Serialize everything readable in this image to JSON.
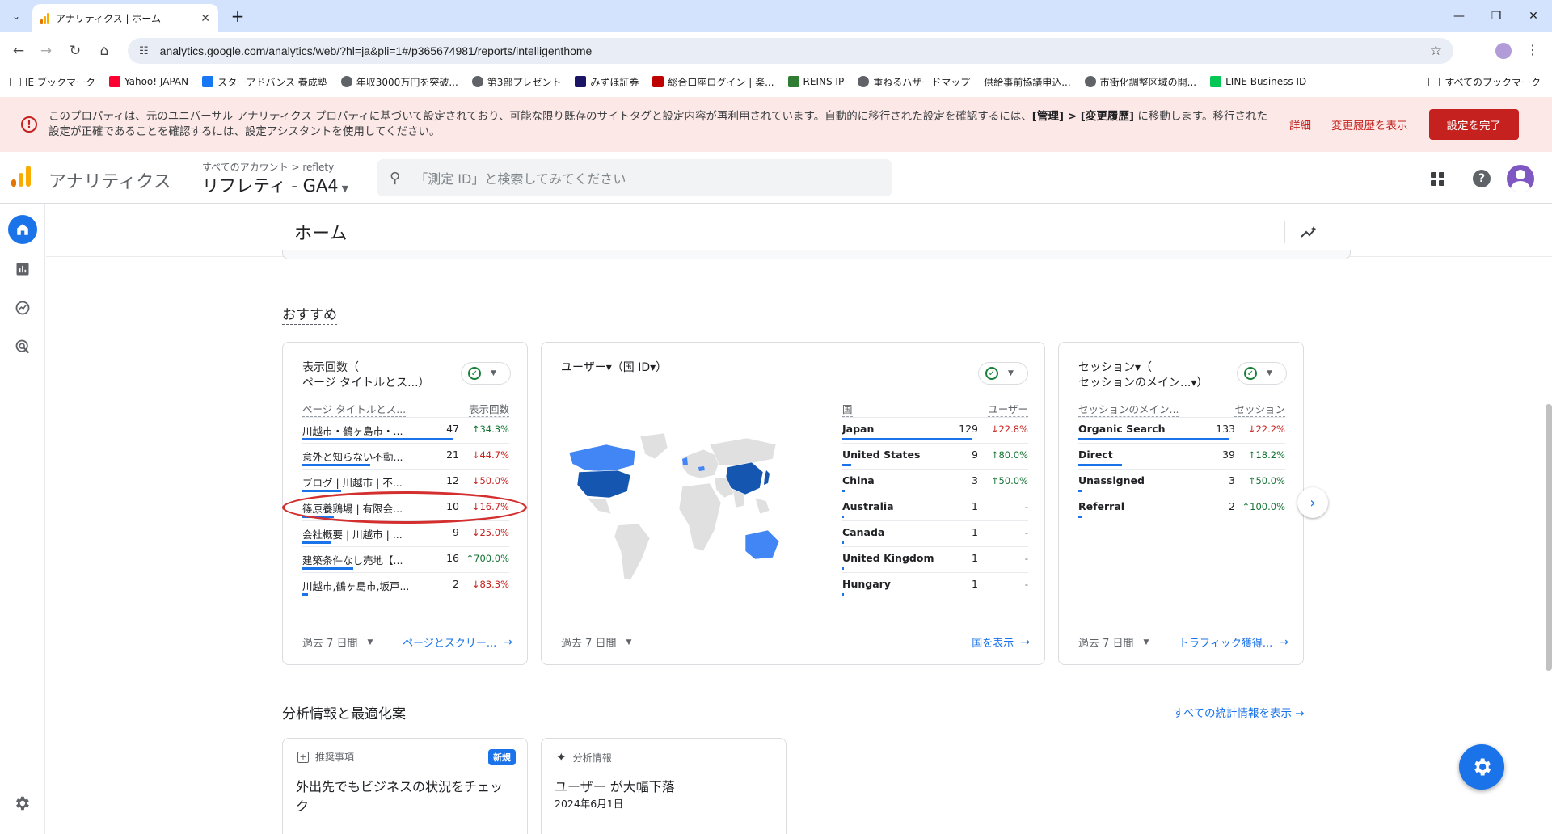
{
  "browser": {
    "tab_title": "アナリティクス | ホーム",
    "url": "analytics.google.com/analytics/web/?hl=ja&pli=1#/p365674981/reports/intelligenthome",
    "bookmarks": [
      {
        "label": "IE ブックマーク",
        "icon": "folder-icon",
        "color": "#5f6368"
      },
      {
        "label": "Yahoo! JAPAN",
        "icon": "yahoo-icon",
        "color": "#ff0033"
      },
      {
        "label": "スターアドバンス 養成塾",
        "icon": "facebook-icon",
        "color": "#1877f2"
      },
      {
        "label": "年収3000万円を突破...",
        "icon": "globe-icon",
        "color": "#5f6368"
      },
      {
        "label": "第3部プレゼント",
        "icon": "globe-icon",
        "color": "#5f6368"
      },
      {
        "label": "みずほ証券",
        "icon": "mizuho-icon",
        "color": "#1b1464"
      },
      {
        "label": "総合口座ログイン | 楽...",
        "icon": "rakuten-icon",
        "color": "#bf0000"
      },
      {
        "label": "REINS IP",
        "icon": "reins-icon",
        "color": "#2e7d32"
      },
      {
        "label": "重ねるハザードマップ",
        "icon": "globe-icon",
        "color": "#5f6368"
      },
      {
        "label": "供給事前協議申込...",
        "icon": "blank-icon",
        "color": "#ffffff"
      },
      {
        "label": "市街化調整区域の開...",
        "icon": "globe-icon",
        "color": "#5f6368"
      },
      {
        "label": "LINE Business ID",
        "icon": "line-icon",
        "color": "#06c755"
      }
    ],
    "all_bookmarks": "すべてのブックマーク"
  },
  "banner": {
    "message_1": "このプロパティは、元のユニバーサル アナリティクス プロパティに基づいて設定されており、可能な限り既存のサイトタグと設定内容が再利用されています。自動的に移行された設定を確認するには、",
    "message_bold": "[管理] > [変更履歴]",
    "message_2": " に移動します。移行された設定が正確であることを確認するには、設定アシスタントを使用してください。",
    "details_link": "詳細",
    "history_link": "変更履歴を表示",
    "done_button": "設定を完了"
  },
  "header": {
    "product": "アナリティクス",
    "breadcrumb": "すべてのアカウント > reflety",
    "property": "リフレティ - GA4",
    "search_placeholder": "「測定 ID」と検索してみてください"
  },
  "main": {
    "title": "ホーム",
    "recommended_heading": "おすすめ",
    "insights_heading": "分析情報と最適化案",
    "all_insights_link": "すべての統計情報を表示"
  },
  "cards": [
    {
      "title_line1": "表示回数（",
      "title_line2": "ページ タイトルとス...）",
      "col_label": "ページ タイトルとス...",
      "col_metric": "表示回数",
      "period": "過去 7 日間",
      "link": "ページとスクリー...",
      "rows": [
        {
          "label": "川越市・鶴ヶ島市・...",
          "value": "47",
          "change": "34.3%",
          "dir": "up",
          "share": 1.0
        },
        {
          "label": "意外と知らない不動...",
          "value": "21",
          "change": "44.7%",
          "dir": "dn",
          "share": 0.45
        },
        {
          "label": "ブログ | 川越市 | 不...",
          "value": "12",
          "change": "50.0%",
          "dir": "dn",
          "share": 0.26
        },
        {
          "label": "篠原養鶏場 | 有限会...",
          "value": "10",
          "change": "16.7%",
          "dir": "dn",
          "share": 0.21
        },
        {
          "label": "会社概要 | 川越市 | ...",
          "value": "9",
          "change": "25.0%",
          "dir": "dn",
          "share": 0.19
        },
        {
          "label": "建築条件なし売地【...",
          "value": "16",
          "change": "700.0%",
          "dir": "up",
          "share": 0.34
        },
        {
          "label": "川越市,鶴ヶ島市,坂戸...",
          "value": "2",
          "change": "83.3%",
          "dir": "dn",
          "share": 0.04
        }
      ]
    },
    {
      "title": "ユーザー▾（国 ID▾）",
      "col_label": "国",
      "col_metric": "ユーザー",
      "period": "過去 7 日間",
      "link": "国を表示",
      "rows": [
        {
          "label": "Japan",
          "value": "129",
          "change": "22.8%",
          "dir": "dn",
          "share": 1.0
        },
        {
          "label": "United States",
          "value": "9",
          "change": "80.0%",
          "dir": "up",
          "share": 0.07
        },
        {
          "label": "China",
          "value": "3",
          "change": "50.0%",
          "dir": "up",
          "share": 0.02
        },
        {
          "label": "Australia",
          "value": "1",
          "change": "-",
          "dir": "nd",
          "share": 0.01
        },
        {
          "label": "Canada",
          "value": "1",
          "change": "-",
          "dir": "nd",
          "share": 0.01
        },
        {
          "label": "United Kingdom",
          "value": "1",
          "change": "-",
          "dir": "nd",
          "share": 0.01
        },
        {
          "label": "Hungary",
          "value": "1",
          "change": "-",
          "dir": "nd",
          "share": 0.01
        }
      ]
    },
    {
      "title_line1": "セッション▾（",
      "title_line2": "セッションのメイン...▾）",
      "col_label": "セッションのメイン...",
      "col_metric": "セッション",
      "period": "過去 7 日間",
      "link": "トラフィック獲得...",
      "rows": [
        {
          "label": "Organic Search",
          "value": "133",
          "change": "22.2%",
          "dir": "dn",
          "share": 1.0
        },
        {
          "label": "Direct",
          "value": "39",
          "change": "18.2%",
          "dir": "up",
          "share": 0.29
        },
        {
          "label": "Unassigned",
          "value": "3",
          "change": "50.0%",
          "dir": "up",
          "share": 0.02
        },
        {
          "label": "Referral",
          "value": "2",
          "change": "100.0%",
          "dir": "up",
          "share": 0.02
        }
      ]
    }
  ],
  "insight_cards": [
    {
      "kind": "推奨事項",
      "badge": "新規",
      "text_line1": "外出先でもビジネスの状況をチェッ",
      "text_line2": "ク"
    },
    {
      "kind": "分析情報",
      "text_line1": "ユーザー が大幅下落",
      "text_line2": "2024年6月1日"
    }
  ],
  "colors": {
    "accent": "#1a73e8",
    "up": "#137333",
    "down": "#c5221f",
    "banner_bg": "#fce8e6",
    "map_high": "#1557b0",
    "map_mid": "#4285f4",
    "map_low": "#e0e0e0"
  }
}
